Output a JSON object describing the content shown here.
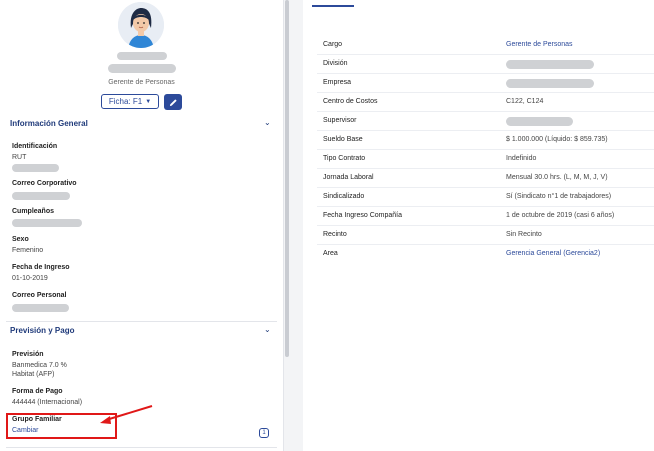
{
  "profile": {
    "role": "Gerente de Personas",
    "ficha_label": "Ficha: F1"
  },
  "general": {
    "title": "Información General",
    "fields": [
      {
        "label": "Identificación",
        "value": "RUT"
      },
      {
        "label": "Correo Corporativo",
        "value": ""
      },
      {
        "label": "Cumpleaños",
        "value": ""
      },
      {
        "label": "Sexo",
        "value": "Femenino"
      },
      {
        "label": "Fecha de Ingreso",
        "value": "01-10-2019"
      },
      {
        "label": "Correo Personal",
        "value": ""
      }
    ]
  },
  "prevision": {
    "title": "Previsión y Pago",
    "prevision_label": "Previsión",
    "prevision_values": [
      "Banmedica 7.0 %",
      "Habitat (AFP)"
    ],
    "pago_label": "Forma de Pago",
    "pago_value": "444444 (Internacional)",
    "grupo_label": "Grupo Familiar",
    "grupo_link": "Cambiar",
    "grupo_count": "1"
  },
  "details": [
    {
      "label": "Cargo",
      "value": "Gerente de Personas",
      "link": true
    },
    {
      "label": "División",
      "value": ""
    },
    {
      "label": "Empresa",
      "value": ""
    },
    {
      "label": "Centro de Costos",
      "value": "C122, C124"
    },
    {
      "label": "Supervisor",
      "value": ""
    },
    {
      "label": "Sueldo Base",
      "value": "$ 1.000.000 (Líquido: $ 859.735)"
    },
    {
      "label": "Tipo Contrato",
      "value": "Indefinido"
    },
    {
      "label": "Jornada Laboral",
      "value": "Mensual 30.0 hrs. (L, M, M, J, V)"
    },
    {
      "label": "Sindicalizado",
      "value": "Sí (Sindicato n°1 de trabajadores)"
    },
    {
      "label": "Fecha Ingreso Compañía",
      "value": "1 de octubre de 2019 (casi 6 años)"
    },
    {
      "label": "Recinto",
      "value": "Sin Recinto"
    },
    {
      "label": "Area",
      "value": "Gerencia General (Gerencia2)",
      "link": true
    }
  ],
  "colors": {
    "accent": "#2c4a9a",
    "highlight": "#e01818"
  }
}
